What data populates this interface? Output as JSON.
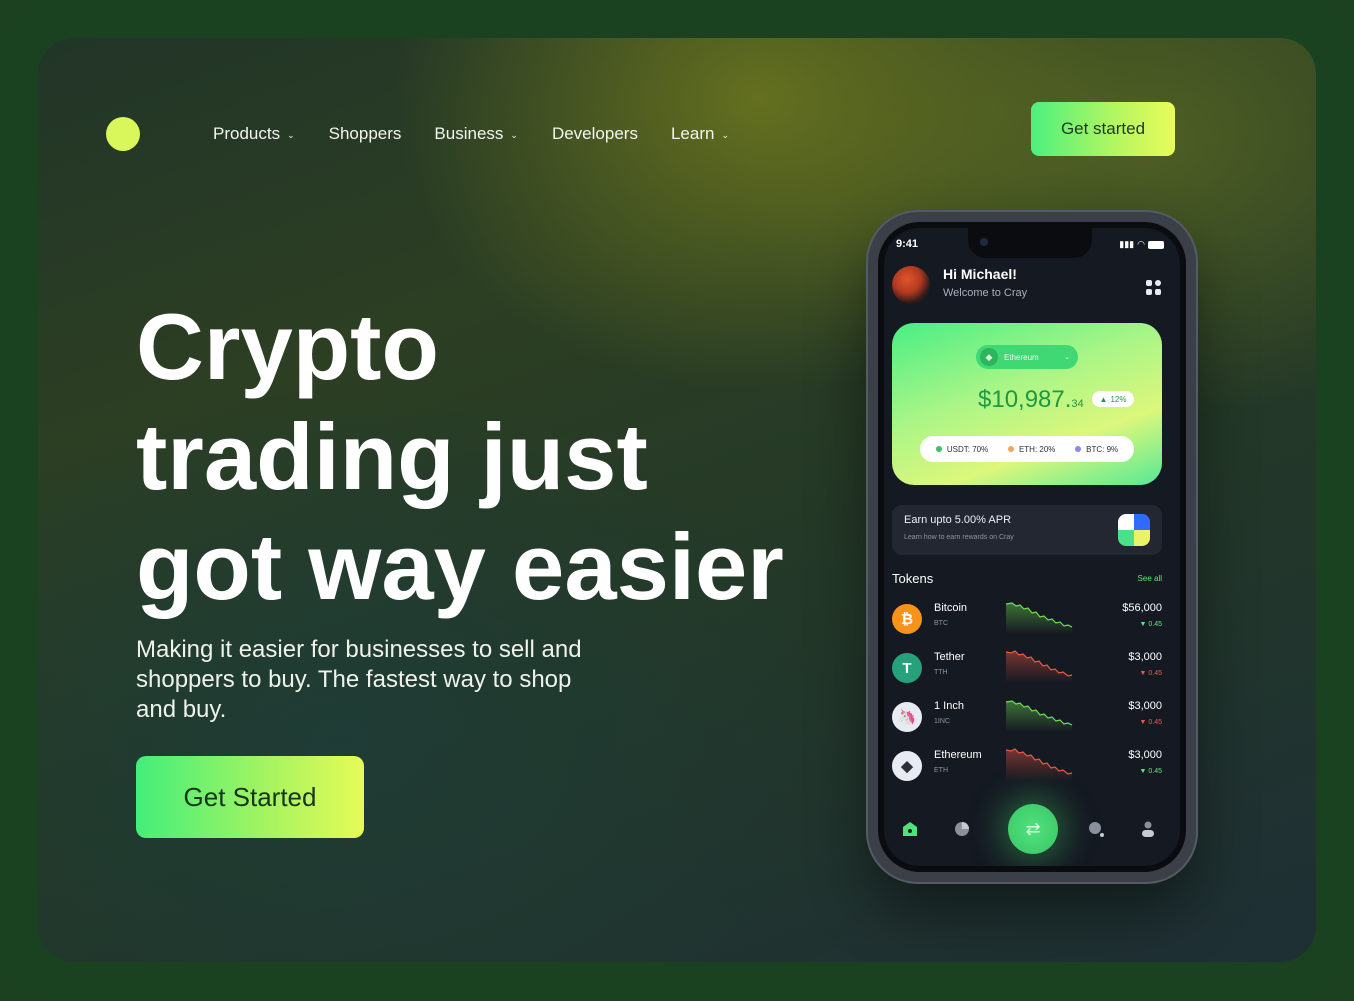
{
  "nav": {
    "items": [
      {
        "label": "Products",
        "dropdown": true
      },
      {
        "label": "Shoppers",
        "dropdown": false
      },
      {
        "label": "Business",
        "dropdown": true
      },
      {
        "label": "Developers",
        "dropdown": false
      },
      {
        "label": "Learn",
        "dropdown": true
      }
    ],
    "cta": "Get started"
  },
  "hero": {
    "headline": [
      "Crypto",
      "trading just",
      "got way easier"
    ],
    "subtext": "Making it easier for businesses to sell and shoppers to buy. The fastest way to shop and buy.",
    "cta": "Get Started"
  },
  "phone": {
    "status_time": "9:41",
    "greeting": "Hi Michael!",
    "welcome": "Welcome to Cray",
    "coin": "Ethereum",
    "balance_main": "$10,987.",
    "balance_cents": "34",
    "change_badge": "12%",
    "allocations": [
      {
        "label": "USDT: 70%",
        "color": "#39c262"
      },
      {
        "label": "ETH: 20%",
        "color": "#f2a65a"
      },
      {
        "label": "BTC: 9%",
        "color": "#8f86f0"
      }
    ],
    "earn": {
      "title": "Earn upto 5.00% APR",
      "subtitle": "Learn how to earn rewards on Cray"
    },
    "tokens_title": "Tokens",
    "see_all": "See all",
    "tokens": [
      {
        "name": "Bitcoin",
        "symbol": "BTC",
        "price": "$56,000",
        "change": "0.45",
        "trend": "up",
        "icon_color": "#f7931a",
        "icon_glyph": "₿",
        "spark": "green"
      },
      {
        "name": "Tether",
        "symbol": "TTH",
        "price": "$3,000",
        "change": "0.45",
        "trend": "down",
        "icon_color": "#26a17b",
        "icon_glyph": "T",
        "spark": "red"
      },
      {
        "name": "1 Inch",
        "symbol": "1INC",
        "price": "$3,000",
        "change": "0.45",
        "trend": "down",
        "icon_color": "#e8ecf2",
        "icon_glyph": "🦄",
        "spark": "green"
      },
      {
        "name": "Ethereum",
        "symbol": "ETH",
        "price": "$3,000",
        "change": "0.45",
        "trend": "up",
        "icon_color": "#e8ecf2",
        "icon_glyph": "◆",
        "spark": "red"
      }
    ],
    "tabs": [
      "home-icon",
      "chart-icon",
      "swap-icon",
      "search-icon",
      "profile-icon"
    ]
  },
  "colors": {
    "accent_green": "#4df07f",
    "accent_yellow": "#e9fb5a",
    "frame": "#1a4221",
    "up": "#5dea7c",
    "down": "#ef5a45"
  }
}
